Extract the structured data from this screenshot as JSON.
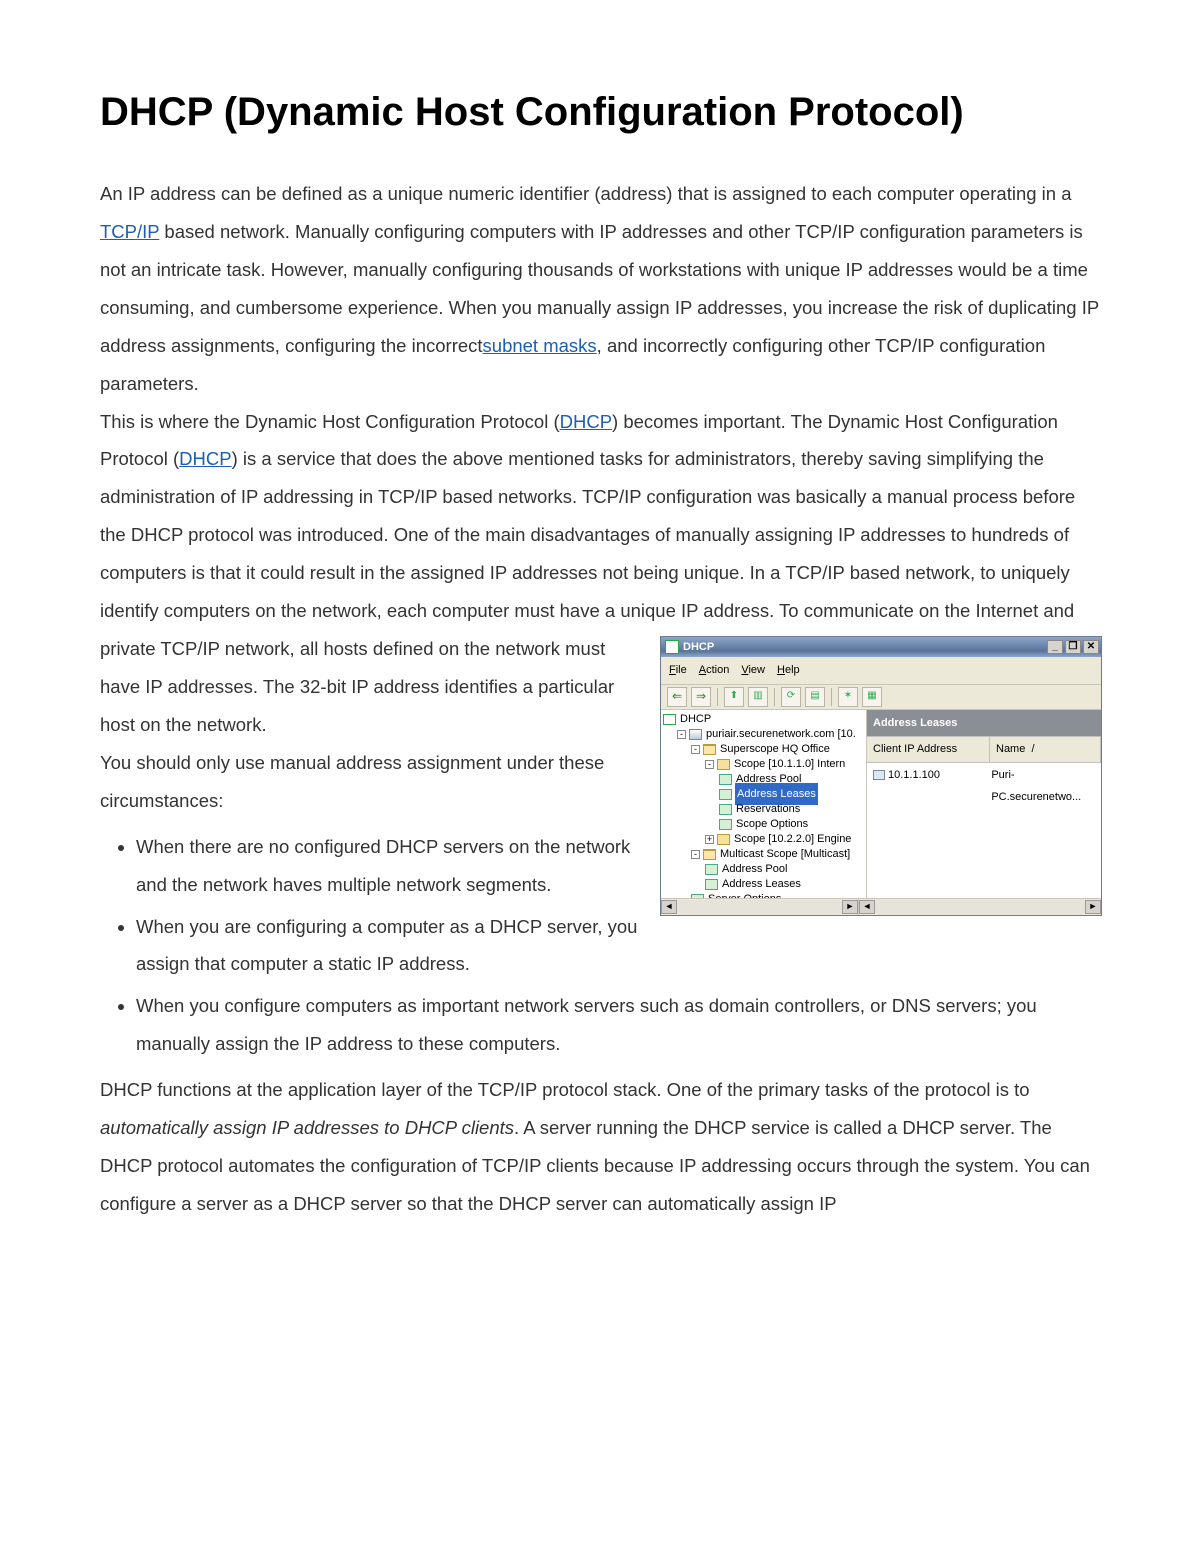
{
  "title": "DHCP (Dynamic Host Configuration Protocol)",
  "para1": {
    "t1": "An IP address can be defined as a unique numeric identifier (address) that is assigned to each computer operating in a ",
    "link1": "TCP/IP",
    "t2": " based network. Manually configuring computers with IP addresses and other TCP/IP configuration parameters is not an intricate task. However, manually configuring thousands of workstations with unique IP addresses would be a time consuming, and cumbersome experience. When you manually assign IP addresses, you increase the risk of duplicating IP address assignments, configuring the incorrect",
    "link2": "subnet masks",
    "t3": ", and incorrectly configuring other TCP/IP configuration parameters."
  },
  "para2": {
    "t1": "This is where the Dynamic Host Configuration Protocol (",
    "link1": "DHCP",
    "t2": ") becomes important. The Dynamic Host Configuration Protocol (",
    "link2": "DHCP",
    "t3": ") is a service that does the above mentioned tasks for administrators, thereby saving simplifying the administration of IP addressing in TCP/IP based networks. TCP/IP configuration was basically a manual process before the DHCP protocol was introduced. One of the main disadvantages of manually assigning IP addresses to hundreds of computers is that it could result in the assigned IP addresses not being unique. In a TCP/IP based network, to uniquely identify computers on the network, each computer must have a unique IP address. To communicate on the Internet and private TCP/IP network, all hosts defined on the network must have IP addresses. The 32-bit IP address identifies a particular host on the network."
  },
  "para3": "You should only use manual address assignment under these circumstances:",
  "bullets": [
    "When there are no configured DHCP servers on the network and the network haves multiple network segments.",
    "When you are configuring a computer as a DHCP server, you assign that computer a static IP address.",
    "When you configure computers as important network servers such as domain controllers, or DNS servers; you manually assign the IP address to these computers."
  ],
  "para4": {
    "t1": "DHCP functions at the application layer of the TCP/IP protocol stack. One of the primary tasks of the protocol is to ",
    "italic": "automatically assign IP addresses to DHCP clients",
    "t2": ". A server running the DHCP service is called a DHCP server. The DHCP protocol automates the configuration of TCP/IP clients because IP addressing occurs through the system. You can configure a server as a DHCP server so that the DHCP server can automatically assign IP"
  },
  "mmc": {
    "title": "DHCP",
    "menu": {
      "file": "File",
      "action": "Action",
      "view": "View",
      "help": "Help"
    },
    "tree": {
      "root": "DHCP",
      "server": "puriair.securenetwork.com [10.",
      "superscope": "Superscope HQ Office",
      "scope1": "Scope [10.1.1.0] Intern",
      "pool": "Address Pool",
      "leases": "Address Leases",
      "reservations": "Reservations",
      "scopeopts": "Scope Options",
      "scope2": "Scope [10.2.2.0] Engine",
      "multicast": "Multicast Scope [Multicast]",
      "pool2": "Address Pool",
      "leases2": "Address Leases",
      "serveropts": "Server Options"
    },
    "right": {
      "header": "Address Leases",
      "col_ip": "Client IP Address",
      "col_name": "Name",
      "row_ip": "10.1.1.100",
      "row_name": "Puri-PC.securenetwo..."
    }
  }
}
